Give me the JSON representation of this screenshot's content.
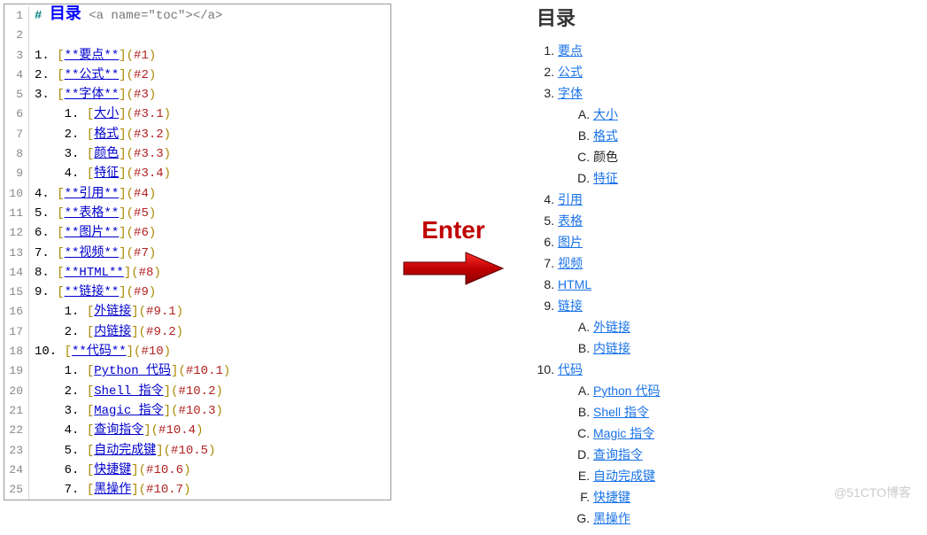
{
  "watermark": "@51CTO博客",
  "arrowLabel": "Enter",
  "source": {
    "headerHash": "#",
    "headerTitle": "目录",
    "anchorTag": "<a name=\"toc\"></a>",
    "lineCount": 25,
    "items": [
      {
        "n": "1",
        "indent": 0,
        "text": "**要点**",
        "href": "#1"
      },
      {
        "n": "2",
        "indent": 0,
        "text": "**公式**",
        "href": "#2"
      },
      {
        "n": "3",
        "indent": 0,
        "text": "**字体**",
        "href": "#3"
      },
      {
        "n": "1",
        "indent": 1,
        "text": "大小",
        "href": "#3.1"
      },
      {
        "n": "2",
        "indent": 1,
        "text": "格式",
        "href": "#3.2"
      },
      {
        "n": "3",
        "indent": 1,
        "text": "颜色",
        "href": "#3.3"
      },
      {
        "n": "4",
        "indent": 1,
        "text": "特征",
        "href": "#3.4"
      },
      {
        "n": "4",
        "indent": 0,
        "text": "**引用**",
        "href": "#4"
      },
      {
        "n": "5",
        "indent": 0,
        "text": "**表格**",
        "href": "#5"
      },
      {
        "n": "6",
        "indent": 0,
        "text": "**图片**",
        "href": "#6"
      },
      {
        "n": "7",
        "indent": 0,
        "text": "**视频**",
        "href": "#7"
      },
      {
        "n": "8",
        "indent": 0,
        "text": "**HTML**",
        "href": "#8"
      },
      {
        "n": "9",
        "indent": 0,
        "text": "**链接**",
        "href": "#9"
      },
      {
        "n": "1",
        "indent": 1,
        "text": "外链接",
        "href": "#9.1"
      },
      {
        "n": "2",
        "indent": 1,
        "text": "内链接",
        "href": "#9.2"
      },
      {
        "n": "10",
        "indent": 0,
        "text": "**代码**",
        "href": "#10"
      },
      {
        "n": "1",
        "indent": 1,
        "text": "Python 代码",
        "href": "#10.1"
      },
      {
        "n": "2",
        "indent": 1,
        "text": "Shell 指令",
        "href": "#10.2"
      },
      {
        "n": "3",
        "indent": 1,
        "text": "Magic 指令",
        "href": "#10.3"
      },
      {
        "n": "4",
        "indent": 1,
        "text": "查询指令",
        "href": "#10.4"
      },
      {
        "n": "5",
        "indent": 1,
        "text": "自动完成键",
        "href": "#10.5"
      },
      {
        "n": "6",
        "indent": 1,
        "text": "快捷键",
        "href": "#10.6"
      },
      {
        "n": "7",
        "indent": 1,
        "text": "黑操作",
        "href": "#10.7"
      }
    ]
  },
  "rendered": {
    "title": "目录",
    "items": [
      {
        "label": "要点",
        "link": true,
        "children": []
      },
      {
        "label": "公式",
        "link": true,
        "children": []
      },
      {
        "label": "字体",
        "link": true,
        "children": [
          {
            "label": "大小",
            "link": true
          },
          {
            "label": "格式",
            "link": true
          },
          {
            "label": "颜色",
            "link": false
          },
          {
            "label": "特征",
            "link": true
          }
        ]
      },
      {
        "label": "引用",
        "link": true,
        "children": []
      },
      {
        "label": "表格",
        "link": true,
        "children": []
      },
      {
        "label": "图片",
        "link": true,
        "children": []
      },
      {
        "label": "视频",
        "link": true,
        "children": []
      },
      {
        "label": "HTML",
        "link": true,
        "children": []
      },
      {
        "label": "链接",
        "link": true,
        "children": [
          {
            "label": "外链接",
            "link": true
          },
          {
            "label": "内链接",
            "link": true
          }
        ]
      },
      {
        "label": "代码",
        "link": true,
        "children": [
          {
            "label": "Python 代码",
            "link": true
          },
          {
            "label": "Shell 指令",
            "link": true
          },
          {
            "label": "Magic 指令",
            "link": true
          },
          {
            "label": "查询指令",
            "link": true
          },
          {
            "label": "自动完成键",
            "link": true
          },
          {
            "label": "快捷键",
            "link": true
          },
          {
            "label": "黑操作",
            "link": true
          }
        ]
      }
    ]
  }
}
